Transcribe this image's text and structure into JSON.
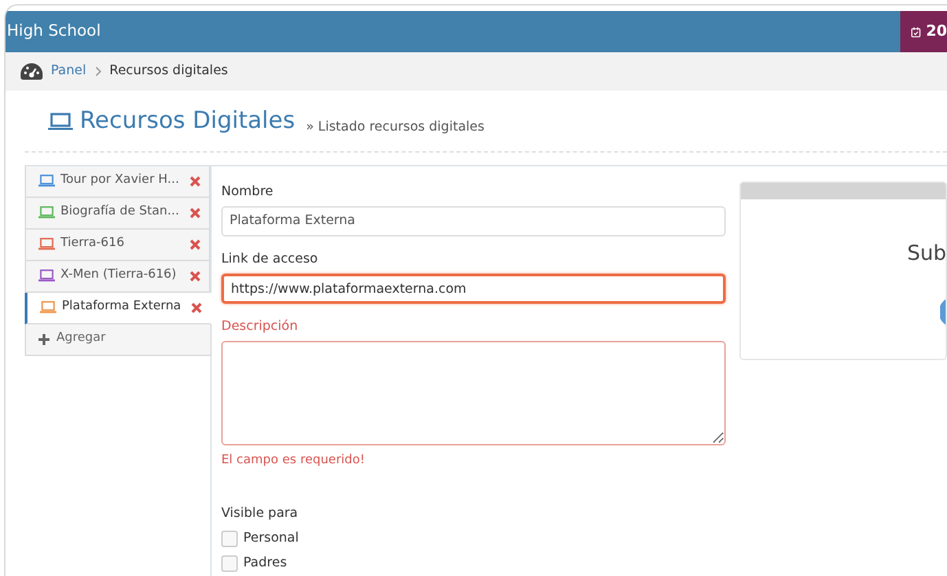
{
  "topbar": {
    "title": "High School",
    "badge": "20"
  },
  "breadcrumb": [
    {
      "label": "Panel",
      "link": true
    },
    {
      "label": "Recursos digitales",
      "link": false
    }
  ],
  "page_header": {
    "title": "Recursos Digitales",
    "subtitle": "» Listado recursos digitales"
  },
  "resources": [
    {
      "label": "Tour por Xavier H...",
      "color": "#4a90d9",
      "selected": false
    },
    {
      "label": "Biografía de Stan...",
      "color": "#5cb85c",
      "selected": false
    },
    {
      "label": "Tierra-616",
      "color": "#e06a50",
      "selected": false
    },
    {
      "label": "X-Men (Tierra-616)",
      "color": "#9b59c6",
      "selected": false
    },
    {
      "label": "Plataforma Externa",
      "color": "#f0954a",
      "selected": true
    }
  ],
  "add_button": "Agregar",
  "fields": [
    {
      "kind": "input",
      "label": "Nombre",
      "value": "Plataforma Externa",
      "focused": false,
      "error": false
    },
    {
      "kind": "input",
      "label": "Link de acceso",
      "value": "https://www.plataformaexterna.com",
      "focused": true,
      "error": false
    },
    {
      "kind": "textarea",
      "label": "Descripción",
      "focused": false,
      "error": true,
      "message": "El campo es requerido!"
    }
  ],
  "visibility": {
    "label": "Visible para",
    "options": [
      {
        "label": "Personal",
        "checked": false
      },
      {
        "label": "Padres",
        "checked": false
      }
    ]
  },
  "side_panel": {
    "text": "Sub"
  }
}
